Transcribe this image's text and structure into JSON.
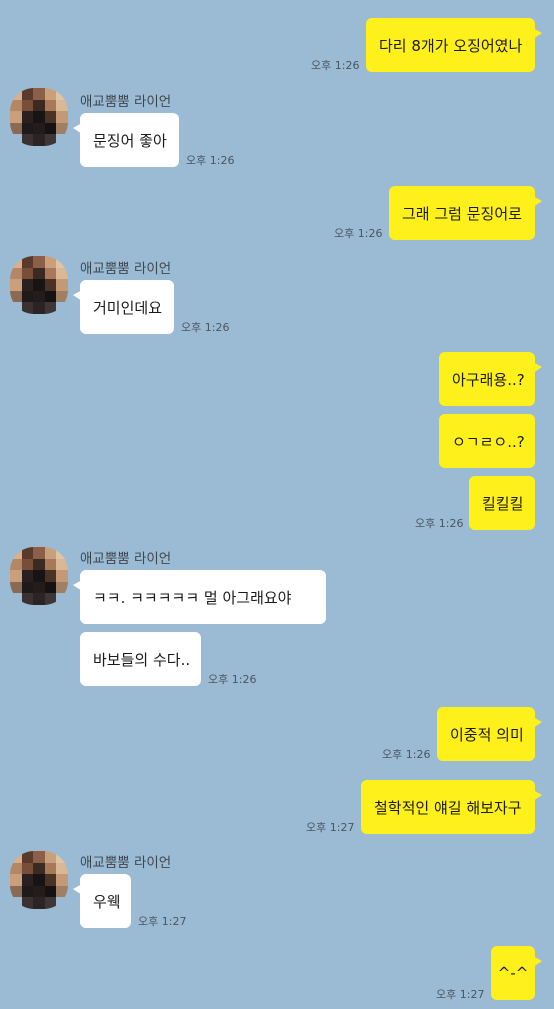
{
  "contact": {
    "name": "애교뿜뿜 라이언",
    "avatar_icon": "pixelated-profile-icon"
  },
  "colors": {
    "background": "#9bbbd4",
    "my_bubble": "#fef01b",
    "their_bubble": "#ffffff"
  },
  "messages": [
    {
      "from": "me",
      "text": "다리 8개가 오징어였나",
      "time": "오후 1:26"
    },
    {
      "from": "them",
      "text": "문징어 좋아",
      "time": "오후 1:26"
    },
    {
      "from": "me",
      "text": "그래 그럼 문징어로",
      "time": "오후 1:26"
    },
    {
      "from": "them",
      "text": "거미인데요",
      "time": "오후 1:26"
    },
    {
      "from": "me",
      "text": "아구래용..?"
    },
    {
      "from": "me",
      "text": "ㅇㄱㄹㅇ..?"
    },
    {
      "from": "me",
      "text": "킬킬킬",
      "time": "오후 1:26"
    },
    {
      "from": "them",
      "text": "ㅋㅋ. ㅋㅋㅋㅋㅋ 멀 아그래요야"
    },
    {
      "from": "them",
      "text": "바보들의 수다..",
      "time": "오후 1:26"
    },
    {
      "from": "me",
      "text": "이중적 의미",
      "time": "오후 1:26"
    },
    {
      "from": "me",
      "text": "철학적인 얘길 해보자구",
      "time": "오후 1:27"
    },
    {
      "from": "them",
      "text": "우웩",
      "time": "오후 1:27"
    },
    {
      "from": "me",
      "text": "^-^",
      "time": "오후 1:27"
    }
  ]
}
